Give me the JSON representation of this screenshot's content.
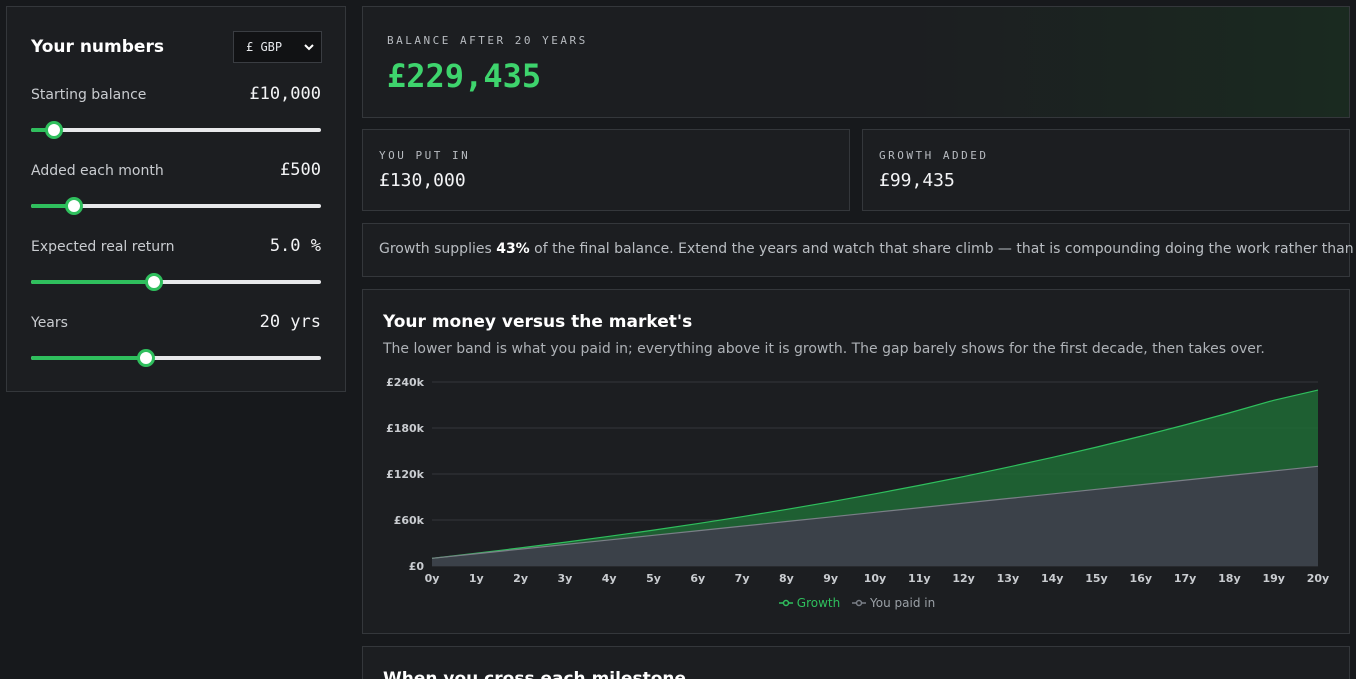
{
  "controls": {
    "title": "Your numbers",
    "currency": {
      "selected": "£ GBP"
    },
    "starting_balance": {
      "label": "Starting balance",
      "value": "£10,000",
      "fraction": 0.05
    },
    "monthly": {
      "label": "Added each month",
      "value": "£500",
      "fraction": 0.125
    },
    "return": {
      "label": "Expected real return",
      "value": "5.0 %",
      "fraction": 0.42
    },
    "years": {
      "label": "Years",
      "value": "20 yrs",
      "fraction": 0.39
    }
  },
  "summary": {
    "balance_kicker": "BALANCE AFTER 20 YEARS",
    "balance_value": "£229,435",
    "put_in_kicker": "YOU PUT IN",
    "put_in_value": "£130,000",
    "growth_kicker": "GROWTH ADDED",
    "growth_value": "£99,435"
  },
  "insight": {
    "prefix": "Growth supplies ",
    "percent": "43%",
    "suffix": " of the final balance. Extend the years and watch that share climb — that is compounding doing the work rather than you."
  },
  "chart": {
    "title": "Your money versus the market's",
    "subtitle": "The lower band is what you paid in; everything above it is growth. The gap barely shows for the first decade, then takes over."
  },
  "chart_data": {
    "type": "area",
    "x": [
      "0y",
      "1y",
      "2y",
      "3y",
      "4y",
      "5y",
      "6y",
      "7y",
      "8y",
      "9y",
      "10y",
      "11y",
      "12y",
      "13y",
      "14y",
      "15y",
      "16y",
      "17y",
      "18y",
      "19y",
      "20y"
    ],
    "y_ticks": [
      "£0",
      "£60k",
      "£120k",
      "£180k",
      "£240k"
    ],
    "ylim": [
      0,
      240000
    ],
    "series": [
      {
        "name": "Growth",
        "color": "#2fbf5d",
        "values": [
          10000,
          16638,
          23621,
          30965,
          38688,
          46809,
          55350,
          64331,
          73777,
          83712,
          94161,
          105149,
          116705,
          128858,
          141639,
          155082,
          169219,
          184087,
          199723,
          216168,
          229435
        ]
      },
      {
        "name": "You paid in",
        "color": "#7a7f87",
        "values": [
          10000,
          16000,
          22000,
          28000,
          34000,
          40000,
          46000,
          52000,
          58000,
          64000,
          70000,
          76000,
          82000,
          88000,
          94000,
          100000,
          106000,
          112000,
          118000,
          124000,
          130000
        ]
      }
    ],
    "legend": "bottom-center",
    "grid": true
  },
  "milestones": {
    "title": "When you cross each milestone"
  }
}
